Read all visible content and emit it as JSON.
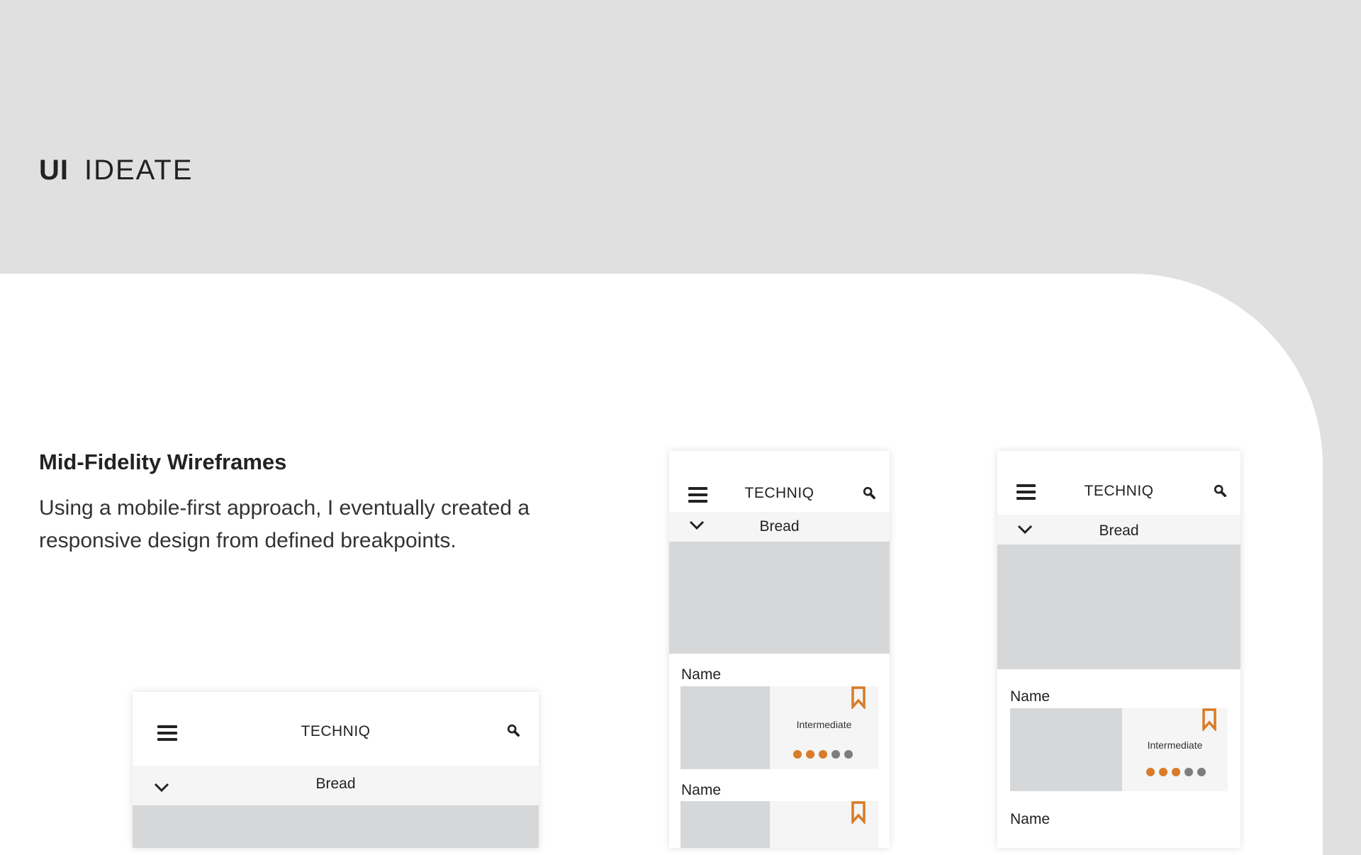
{
  "header": {
    "ui_label": "UI",
    "section_label": "IDEATE"
  },
  "intro": {
    "heading": "Mid-Fidelity Wireframes",
    "body": "Using a mobile-first approach, I eventually created a responsive design from defined breakpoints."
  },
  "wireframe": {
    "brand": "TECHNIQ",
    "category": "Bread",
    "card_name": "Name",
    "level": "Intermediate",
    "difficulty_rating": {
      "value": 3,
      "max": 5
    },
    "colors": {
      "accent": "#d97b27",
      "inactive": "#7d7d7d",
      "placeholder": "#d6d7d8",
      "bar": "#f4f5f4"
    }
  },
  "icons": [
    "hamburger-menu-icon",
    "search-icon",
    "chevron-down-icon",
    "bookmark-icon"
  ]
}
